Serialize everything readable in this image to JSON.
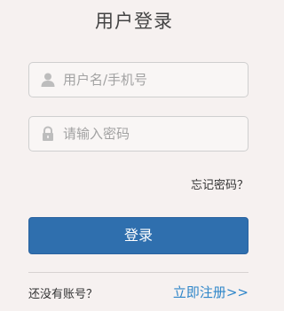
{
  "title": "用户登录",
  "username": {
    "placeholder": "用户名/手机号",
    "icon": "user-icon"
  },
  "password": {
    "placeholder": "请输入密码",
    "icon": "lock-icon"
  },
  "forgot_password": "忘记密码？",
  "login_button": "登录",
  "no_account": "还没有账号？",
  "register_link": "立即注册>>",
  "colors": {
    "primary": "#2f6fae",
    "link": "#2f86c9",
    "background": "#f6f1f0"
  }
}
